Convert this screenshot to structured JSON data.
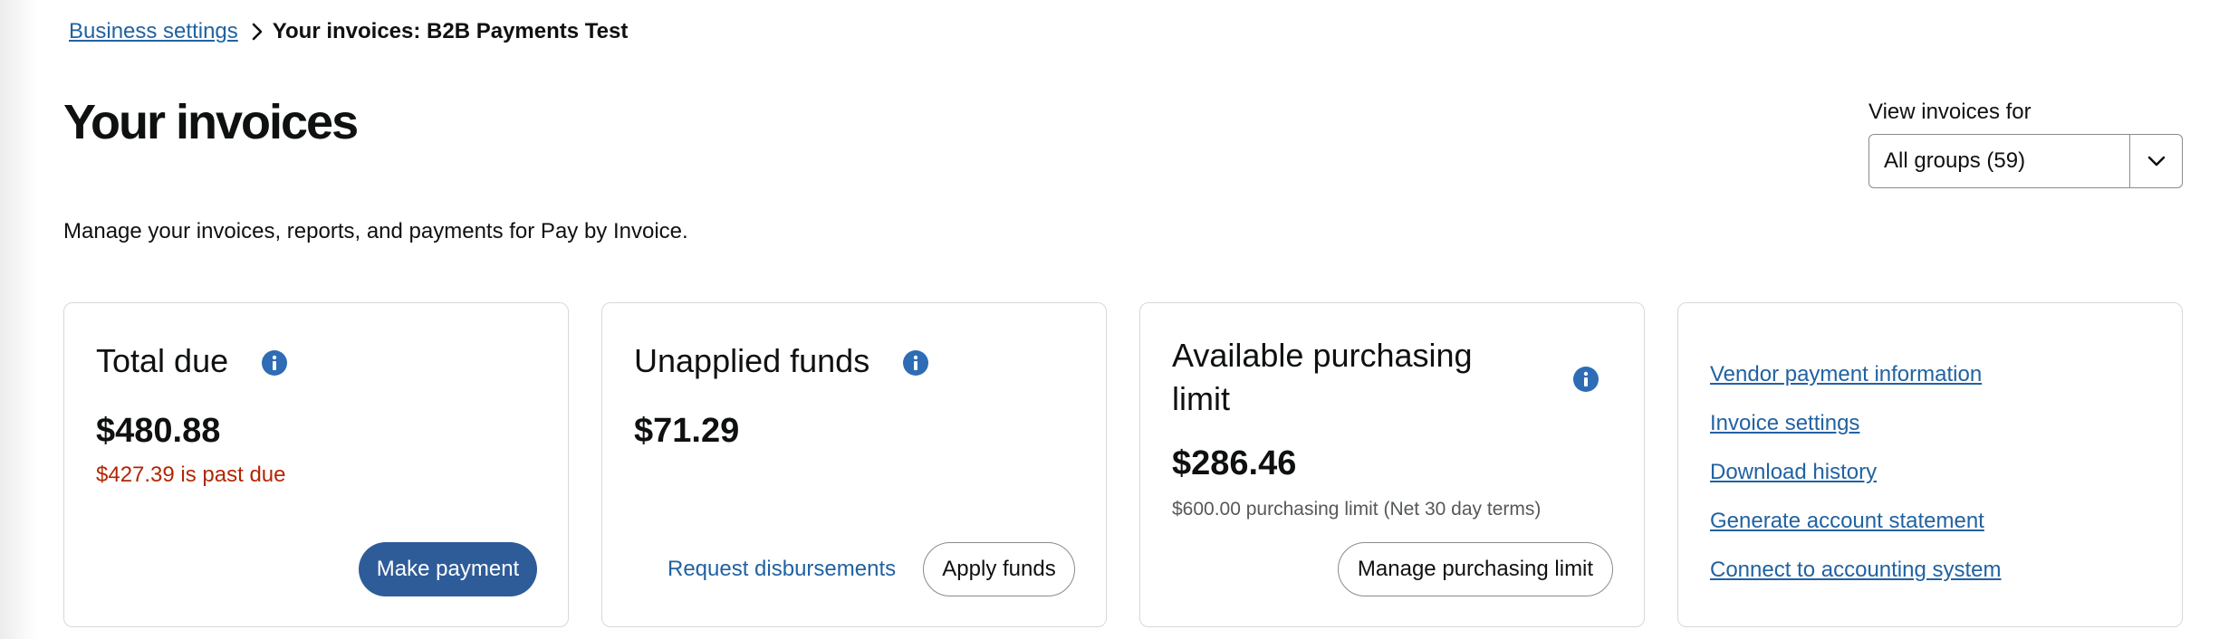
{
  "breadcrumb": {
    "parent_label": "Business settings",
    "current_label": "Your invoices: B2B Payments Test"
  },
  "page": {
    "title": "Your invoices",
    "subtitle": "Manage your invoices, reports, and payments for Pay by Invoice."
  },
  "group_filter": {
    "label": "View invoices for",
    "selected": "All groups (59)"
  },
  "cards": {
    "total_due": {
      "title": "Total due",
      "amount": "$480.88",
      "past_due": "$427.39 is past due",
      "button": "Make payment"
    },
    "unapplied_funds": {
      "title": "Unapplied funds",
      "amount": "$71.29",
      "link": "Request disbursements",
      "button": "Apply funds"
    },
    "purchasing_limit": {
      "title": "Available purchasing limit",
      "amount": "$286.46",
      "note": "$600.00 purchasing limit (Net 30 day terms)",
      "button": "Manage purchasing limit"
    },
    "links": [
      {
        "label": "Vendor payment information"
      },
      {
        "label": "Invoice settings"
      },
      {
        "label": "Download history"
      },
      {
        "label": "Generate account statement"
      },
      {
        "label": "Connect to accounting system"
      }
    ]
  },
  "icons": {
    "info": "info-icon",
    "breadcrumb_separator": "chevron-right-icon",
    "dropdown": "chevron-down-icon"
  },
  "colors": {
    "link": "#2162a1",
    "primary_button": "#2e5c98",
    "info_icon": "#2e6cb5",
    "past_due": "#b12704",
    "border": "#d5d9d9"
  }
}
